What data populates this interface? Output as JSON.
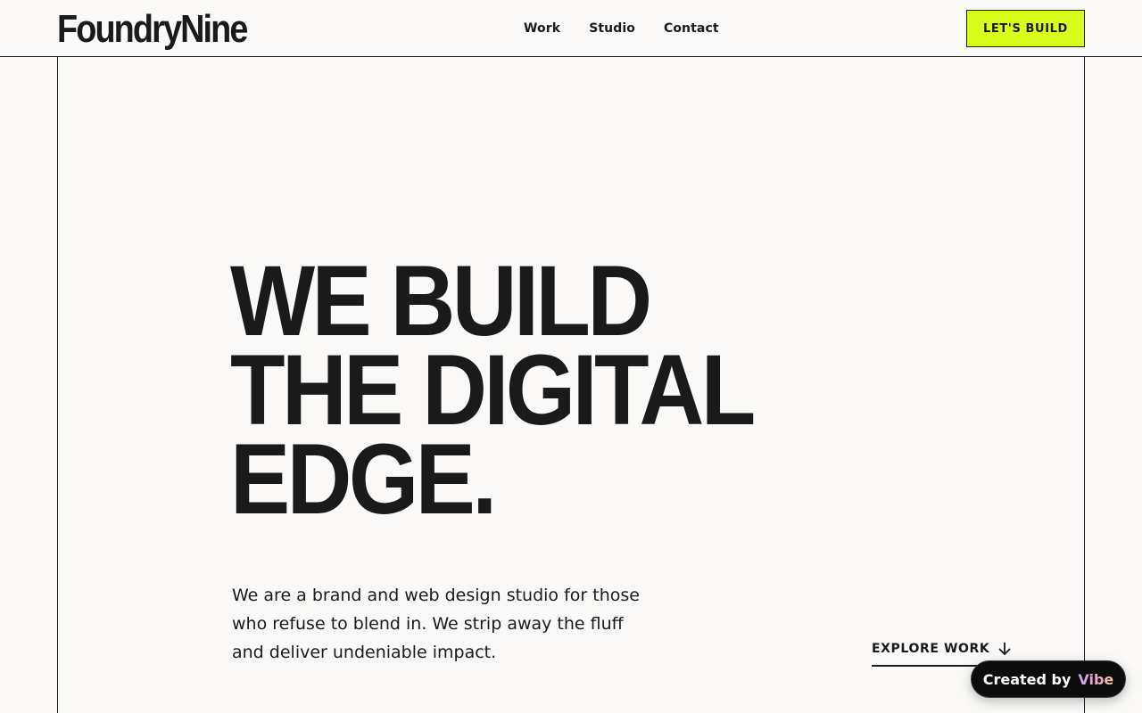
{
  "header": {
    "logo": "FoundryNine",
    "nav": [
      {
        "label": "Work"
      },
      {
        "label": "Studio"
      },
      {
        "label": "Contact"
      }
    ],
    "cta_label": "LET'S BUILD"
  },
  "hero": {
    "title_lines": [
      "WE BUILD",
      "THE DIGITAL",
      "EDGE."
    ],
    "description": "We are a brand and web design studio for those who refuse to blend in. We strip away the fluff and deliver undeniable impact.",
    "explore_label": "EXPLORE WORK",
    "explore_icon": "arrow-down-icon"
  },
  "badge": {
    "prefix": "Created by",
    "brand": "Vibe"
  },
  "colors": {
    "background": "#faf9f7",
    "ink": "#1a1a1a",
    "accent": "#d8ff1c",
    "badge_bg": "#0c0c0c"
  }
}
